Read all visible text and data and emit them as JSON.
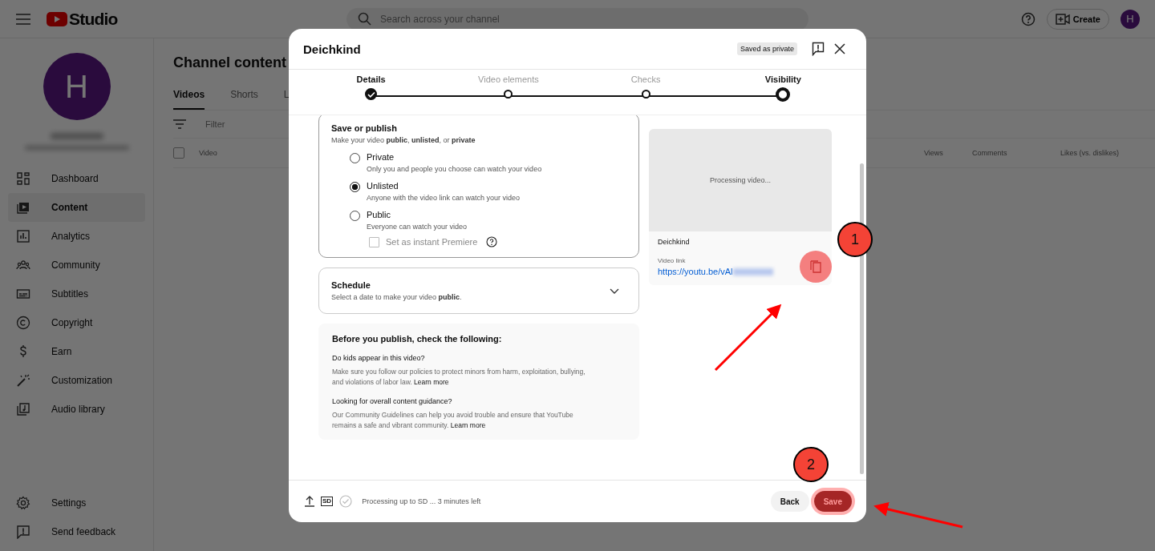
{
  "header": {
    "logo_text": "Studio",
    "search_placeholder": "Search across your channel",
    "create_label": "Create",
    "avatar_letter": "H"
  },
  "sidebar": {
    "avatar_letter": "H",
    "items": [
      {
        "label": "Dashboard",
        "selected": false
      },
      {
        "label": "Content",
        "selected": true
      },
      {
        "label": "Analytics",
        "selected": false
      },
      {
        "label": "Community",
        "selected": false
      },
      {
        "label": "Subtitles",
        "selected": false
      },
      {
        "label": "Copyright",
        "selected": false
      },
      {
        "label": "Earn",
        "selected": false
      },
      {
        "label": "Customization",
        "selected": false
      },
      {
        "label": "Audio library",
        "selected": false
      }
    ],
    "footer_items": [
      {
        "label": "Settings"
      },
      {
        "label": "Send feedback"
      }
    ]
  },
  "main": {
    "title": "Channel content",
    "tabs": [
      {
        "label": "Videos",
        "selected": true
      },
      {
        "label": "Shorts",
        "selected": false
      },
      {
        "label": "L",
        "selected": false
      }
    ],
    "filter_placeholder": "Filter",
    "select_all_checked": false,
    "columns": [
      "Video",
      "Views",
      "Comments",
      "Likes (vs. dislikes)"
    ]
  },
  "dialog": {
    "title": "Deichkind",
    "badge": "Saved as private",
    "steps": [
      {
        "label": "Details",
        "done": true,
        "selected": false
      },
      {
        "label": "Video elements",
        "done": false,
        "selected": false
      },
      {
        "label": "Checks",
        "done": false,
        "selected": false
      },
      {
        "label": "Visibility",
        "done": false,
        "selected": true
      }
    ],
    "visibility": {
      "title": "Save or publish",
      "subtitle": "Make your video **public**, **unlisted**, or **private**",
      "options": [
        {
          "label": "Private",
          "description": "Only you and people you choose can watch your video",
          "selected": false
        },
        {
          "label": "Unlisted",
          "description": "Anyone with the video link can watch your video",
          "selected": true
        },
        {
          "label": "Public",
          "description": "Everyone can watch your video",
          "selected": false
        }
      ],
      "premiere": {
        "label": "Set as instant Premiere",
        "checked": false,
        "disabled": true
      }
    },
    "schedule": {
      "title": "Schedule",
      "subtitle": "Select a date to make your video **public**.",
      "expanded": false
    },
    "checklist": {
      "heading": "Before you publish, check the following:",
      "sections": [
        {
          "title": "Do kids appear in this video?",
          "text": "Make sure you follow our policies to protect minors from harm, exploitation, bullying, and violations of labor law.",
          "link": "Learn more"
        },
        {
          "title": "Looking for overall content guidance?",
          "text": "Our Community Guidelines can help you avoid trouble and ensure that YouTube remains a safe and vibrant community.",
          "link": "Learn more"
        }
      ]
    },
    "preview": {
      "status": "Processing video...",
      "video_title": "Deichkind",
      "link_label": "Video link",
      "link": "https://youtu.be/vAl"
    },
    "footer": {
      "quality_badge": "SD",
      "status": "Processing up to SD ... 3 minutes left",
      "back_label": "Back",
      "save_label": "Save"
    }
  },
  "annotations": [
    {
      "number": "1"
    },
    {
      "number": "2"
    }
  ]
}
